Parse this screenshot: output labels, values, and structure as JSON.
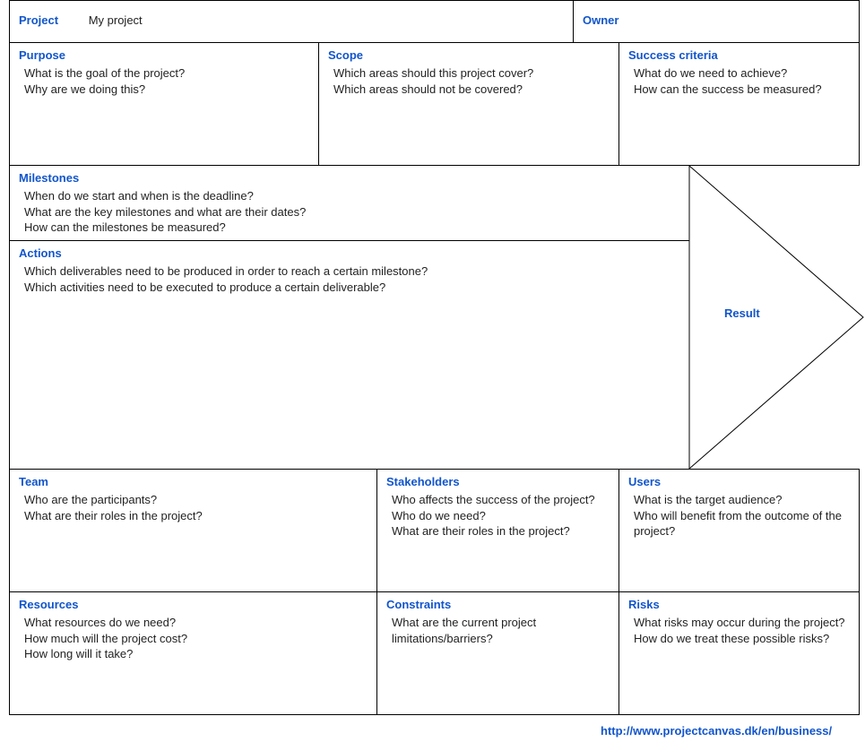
{
  "header": {
    "project_label": "Project",
    "project_value": "My project",
    "owner_label": "Owner"
  },
  "purpose": {
    "title": "Purpose",
    "q1": "What is the goal of the project?",
    "q2": "Why are we doing this?"
  },
  "scope": {
    "title": "Scope",
    "q1": "Which areas should this project cover?",
    "q2": "Which areas should not be covered?"
  },
  "success": {
    "title": "Success criteria",
    "q1": "What do we need to achieve?",
    "q2": "How can the success be measured?"
  },
  "milestones": {
    "title": "Milestones",
    "q1": "When do we start and when is the deadline?",
    "q2": "What are the key milestones and what are their dates?",
    "q3": "How can the milestones be measured?"
  },
  "actions": {
    "title": "Actions",
    "q1": "Which deliverables need to be produced in order to reach a certain milestone?",
    "q2": "Which activities need to be executed to produce a certain deliverable?"
  },
  "result": {
    "title": "Result"
  },
  "team": {
    "title": "Team",
    "q1": "Who are the participants?",
    "q2": "What are their roles in the project?"
  },
  "stakeholders": {
    "title": "Stakeholders",
    "q1": "Who affects the success of the project?",
    "q2": "Who do we need?",
    "q3": "What are their roles in the project?"
  },
  "users": {
    "title": "Users",
    "q1": "What is the target audience?",
    "q2": "Who will benefit from the outcome of the project?"
  },
  "resources": {
    "title": "Resources",
    "q1": "What resources do we need?",
    "q2": "How much will the project cost?",
    "q3": "How long will it take?"
  },
  "constraints": {
    "title": "Constraints",
    "q1": "What are the current project limitations/barriers?"
  },
  "risks": {
    "title": "Risks",
    "q1": "What risks may occur during the project?",
    "q2": "How do we treat these possible risks?"
  },
  "footer": {
    "url": "http://www.projectcanvas.dk/en/business/"
  }
}
